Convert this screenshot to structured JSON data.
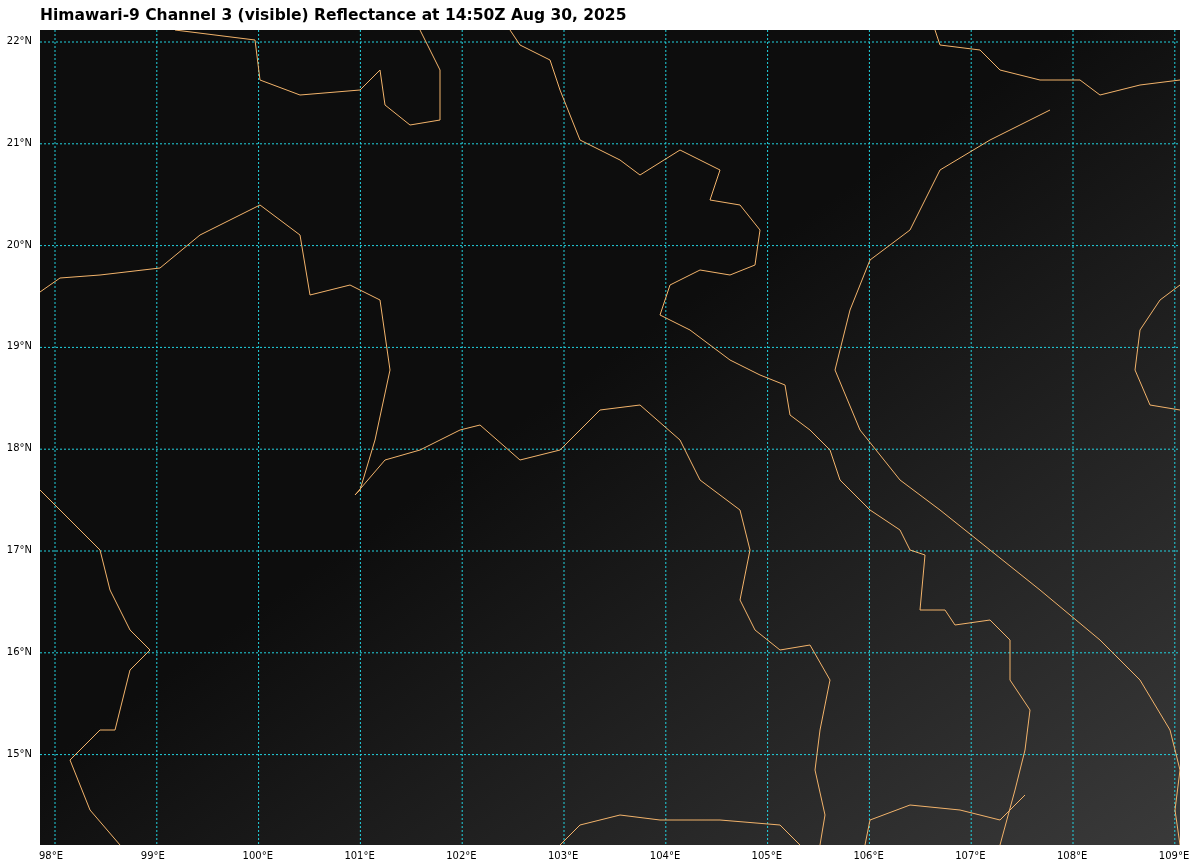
{
  "title": "Himawari-9 Channel 3 (visible) Reflectance at 14:50Z Aug 30, 2025",
  "map": {
    "lat_labels": [
      "22°N",
      "21°N",
      "20°N",
      "19°N",
      "18°N",
      "17°N",
      "16°N",
      "15°N"
    ],
    "lon_labels": [
      "98°E",
      "99°E",
      "100°E",
      "101°E",
      "102°E",
      "103°E",
      "104°E",
      "105°E",
      "106°E",
      "107°E",
      "108°E",
      "109°E"
    ]
  }
}
